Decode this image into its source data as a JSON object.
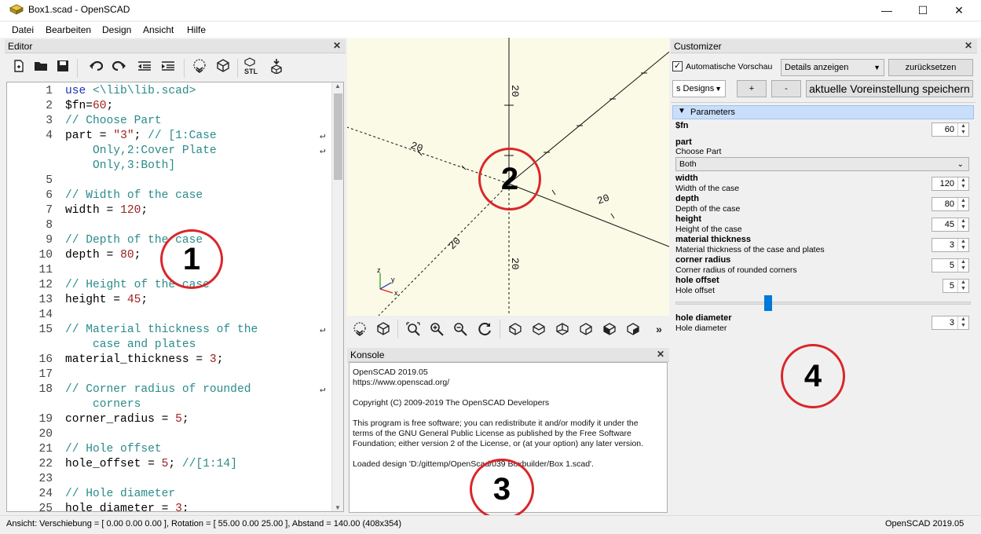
{
  "window": {
    "title": "Box1.scad - OpenSCAD",
    "minimize_label": "—",
    "maximize_label": "☐",
    "close_label": "✕"
  },
  "menu": [
    "Datei",
    "Bearbeiten",
    "Design",
    "Ansicht",
    "Hilfe"
  ],
  "editor": {
    "title": "Editor",
    "toolbar": {
      "stl_label": "STL"
    },
    "lines": [
      {
        "n": "1",
        "parts": [
          [
            "k",
            "use "
          ],
          [
            "c",
            "<\\lib\\lib.scad>"
          ]
        ]
      },
      {
        "n": "2",
        "parts": [
          [
            "",
            "$fn="
          ],
          [
            "n",
            "60"
          ],
          [
            "",
            ";"
          ]
        ]
      },
      {
        "n": "3",
        "parts": [
          [
            "c",
            "// Choose Part"
          ]
        ]
      },
      {
        "n": "4",
        "parts": [
          [
            "",
            "part = "
          ],
          [
            "s",
            "\"3\""
          ],
          [
            "",
            "; "
          ],
          [
            "c",
            "// [1:Case"
          ]
        ],
        "wrap": true
      },
      {
        "n": "",
        "parts": [
          [
            "c",
            "    Only,2:Cover Plate"
          ]
        ],
        "wrap": true
      },
      {
        "n": "",
        "parts": [
          [
            "c",
            "    Only,3:Both]"
          ]
        ]
      },
      {
        "n": "5",
        "parts": []
      },
      {
        "n": "6",
        "parts": [
          [
            "c",
            "// Width of the case"
          ]
        ]
      },
      {
        "n": "7",
        "parts": [
          [
            "",
            "width = "
          ],
          [
            "n",
            "120"
          ],
          [
            "",
            ";"
          ]
        ]
      },
      {
        "n": "8",
        "parts": []
      },
      {
        "n": "9",
        "parts": [
          [
            "c",
            "// Depth of the case"
          ]
        ]
      },
      {
        "n": "10",
        "parts": [
          [
            "",
            "depth = "
          ],
          [
            "n",
            "80"
          ],
          [
            "",
            ";"
          ]
        ]
      },
      {
        "n": "11",
        "parts": []
      },
      {
        "n": "12",
        "parts": [
          [
            "c",
            "// Height of the case"
          ]
        ]
      },
      {
        "n": "13",
        "parts": [
          [
            "",
            "height = "
          ],
          [
            "n",
            "45"
          ],
          [
            "",
            ";"
          ]
        ]
      },
      {
        "n": "14",
        "parts": []
      },
      {
        "n": "15",
        "parts": [
          [
            "c",
            "// Material thickness of the"
          ]
        ],
        "wrap": true
      },
      {
        "n": "",
        "parts": [
          [
            "c",
            "    case and plates"
          ]
        ]
      },
      {
        "n": "16",
        "parts": [
          [
            "",
            "material_thickness = "
          ],
          [
            "n",
            "3"
          ],
          [
            "",
            ";"
          ]
        ]
      },
      {
        "n": "17",
        "parts": []
      },
      {
        "n": "18",
        "parts": [
          [
            "c",
            "// Corner radius of rounded"
          ]
        ],
        "wrap": true
      },
      {
        "n": "",
        "parts": [
          [
            "c",
            "    corners"
          ]
        ]
      },
      {
        "n": "19",
        "parts": [
          [
            "",
            "corner_radius = "
          ],
          [
            "n",
            "5"
          ],
          [
            "",
            ";"
          ]
        ]
      },
      {
        "n": "20",
        "parts": []
      },
      {
        "n": "21",
        "parts": [
          [
            "c",
            "// Hole offset"
          ]
        ]
      },
      {
        "n": "22",
        "parts": [
          [
            "",
            "hole_offset = "
          ],
          [
            "n",
            "5"
          ],
          [
            "",
            "; "
          ],
          [
            "c",
            "//[1:14]"
          ]
        ]
      },
      {
        "n": "23",
        "parts": []
      },
      {
        "n": "24",
        "parts": [
          [
            "c",
            "// Hole diameter"
          ]
        ]
      },
      {
        "n": "25",
        "parts": [
          [
            "",
            "hole_diameter = "
          ],
          [
            "n",
            "3"
          ],
          [
            "",
            ";"
          ]
        ]
      }
    ]
  },
  "viewport": {
    "axis_labels": [
      "20",
      "20",
      "20",
      "20",
      "20"
    ]
  },
  "console": {
    "title": "Konsole",
    "lines": [
      "OpenSCAD 2019.05",
      "https://www.openscad.org/",
      "",
      "Copyright (C) 2009-2019 The OpenSCAD Developers",
      "",
      "This program is free software; you can redistribute it and/or modify it under the",
      "terms of the GNU General Public License as published by the Free Software",
      "Foundation; either version 2 of the License, or (at your option) any later version.",
      "",
      "Loaded design 'D:/gittemp/OpenScad/039 Boxbuilder/Box 1.scad'."
    ]
  },
  "customizer": {
    "title": "Customizer",
    "auto_preview": "Automatische Vorschau",
    "details": "Details anzeigen",
    "reset": "zurücksetzen",
    "preset": "s Designs",
    "plus": "+",
    "minus": "-",
    "save_preset": "aktuelle Voreinstellung speichern",
    "parameters_header": "Parameters",
    "part_name": "part",
    "part_desc": "Choose Part",
    "part_value": "Both",
    "params": [
      {
        "name": "$fn",
        "desc": "",
        "value": "60"
      },
      {
        "name": "width",
        "desc": "Width of the case",
        "value": "120"
      },
      {
        "name": "depth",
        "desc": "Depth of the case",
        "value": "80"
      },
      {
        "name": "height",
        "desc": "Height of the case",
        "value": "45"
      },
      {
        "name": "material thickness",
        "desc": "Material thickness of the case and plates",
        "value": "3"
      },
      {
        "name": "corner radius",
        "desc": "Corner radius of rounded corners",
        "value": "5"
      },
      {
        "name": "hole offset",
        "desc": "Hole offset",
        "value": "5"
      },
      {
        "name": "hole diameter",
        "desc": "Hole diameter",
        "value": "3"
      }
    ],
    "slider": {
      "min": 1,
      "max": 14,
      "value": 5
    }
  },
  "annotations": [
    "1",
    "2",
    "3",
    "4"
  ],
  "status": {
    "left": "Ansicht: Verschiebung = [ 0.00 0.00 0.00 ], Rotation = [ 55.00 0.00 25.00 ], Abstand = 140.00 (408x354)",
    "right": "OpenSCAD 2019.05"
  }
}
